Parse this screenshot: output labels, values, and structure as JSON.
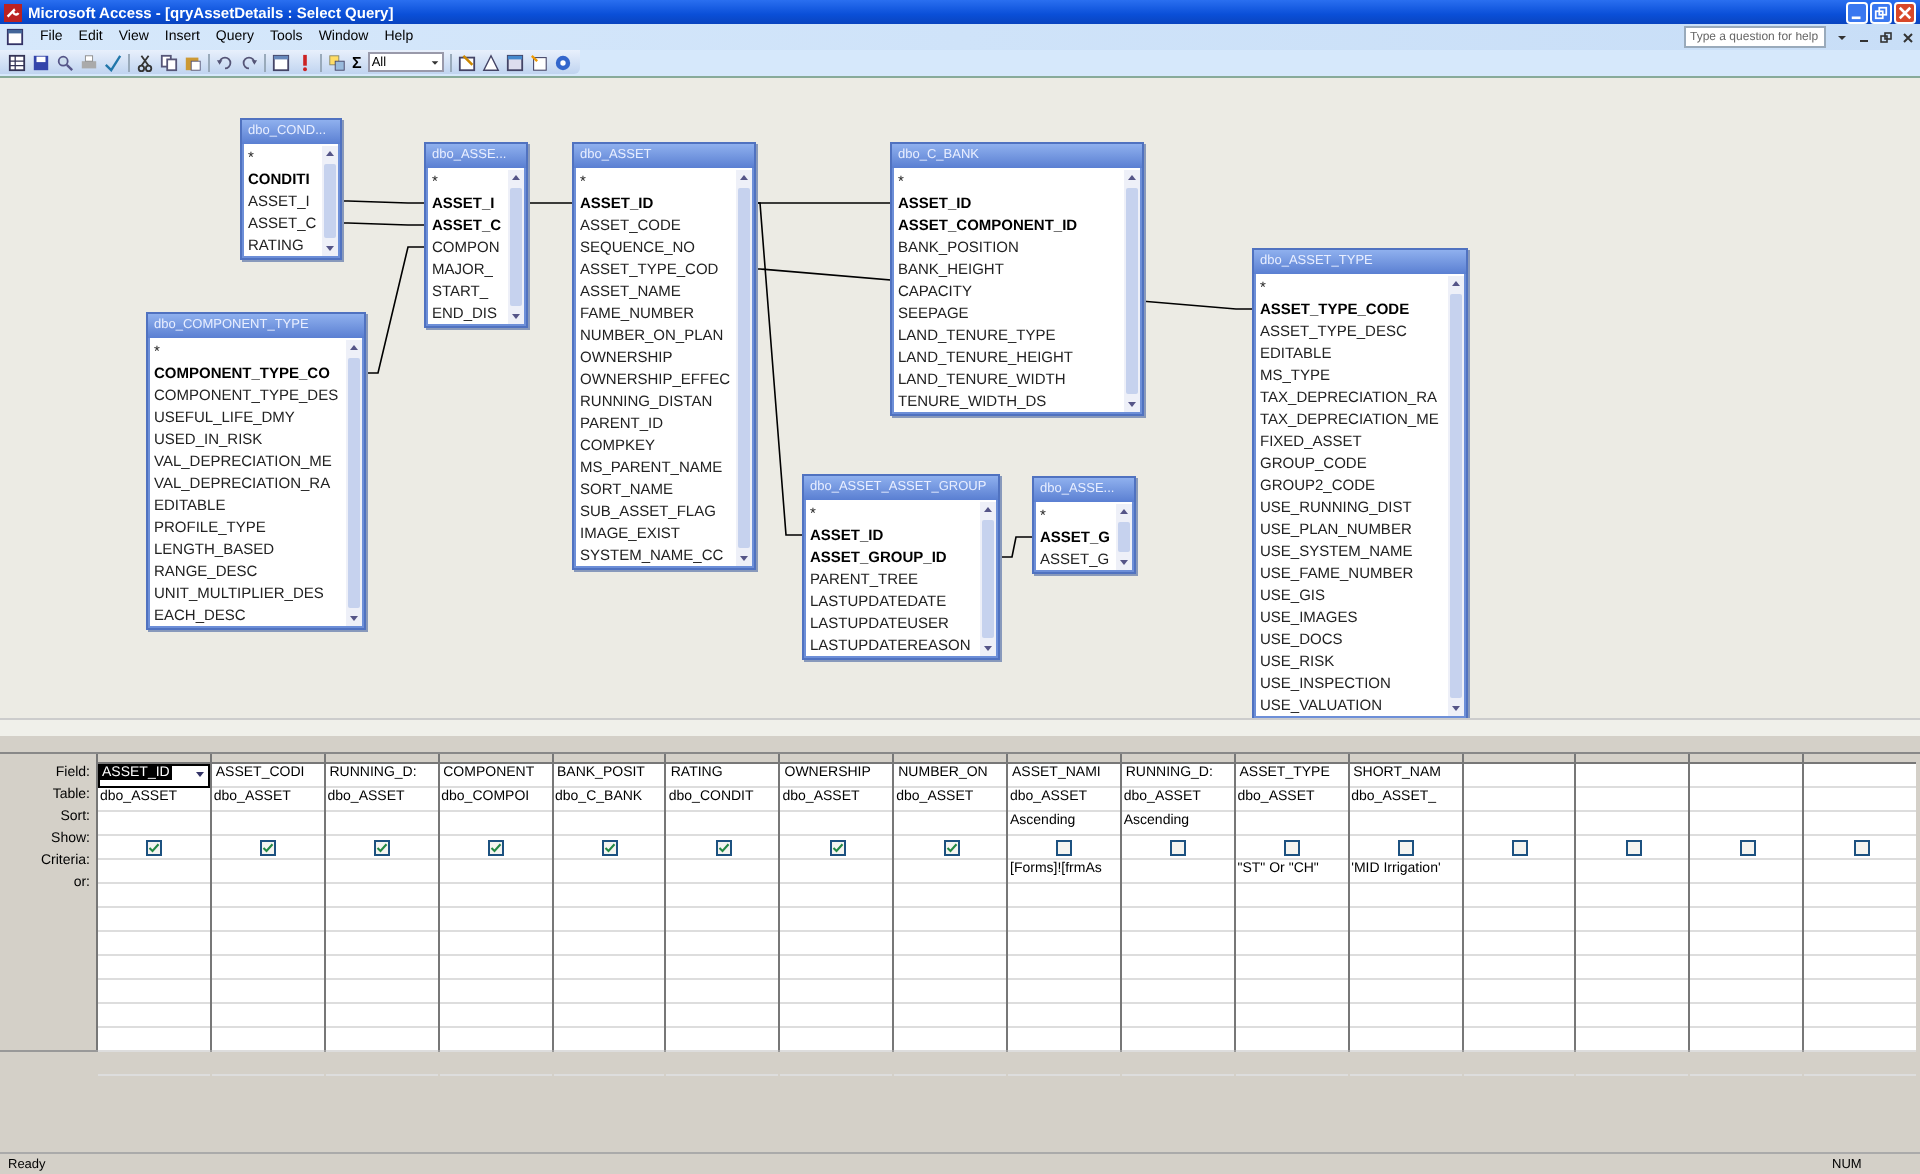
{
  "window": {
    "title": "Microsoft Access - [qryAssetDetails : Select Query]"
  },
  "menu": [
    "File",
    "Edit",
    "View",
    "Insert",
    "Query",
    "Tools",
    "Window",
    "Help"
  ],
  "help_box": {
    "placeholder": "Type a question for help"
  },
  "toolbar": {
    "totals_symbol": "Σ",
    "top_values": "All"
  },
  "tables": [
    {
      "title": "dbo_COND...",
      "fields": [
        {
          "name": "*",
          "key": false
        },
        {
          "name": "CONDITI",
          "key": true
        },
        {
          "name": "ASSET_I",
          "key": false
        },
        {
          "name": "ASSET_C",
          "key": false
        },
        {
          "name": "RATING",
          "key": false
        }
      ]
    },
    {
      "title": "dbo_ASSE...",
      "fields": [
        {
          "name": "*",
          "key": false
        },
        {
          "name": "ASSET_I",
          "key": true
        },
        {
          "name": "ASSET_C",
          "key": true
        },
        {
          "name": "COMPON",
          "key": false
        },
        {
          "name": "MAJOR_",
          "key": false
        },
        {
          "name": "START_",
          "key": false
        },
        {
          "name": "END_DIS",
          "key": false
        }
      ]
    },
    {
      "title": "dbo_ASSET",
      "fields": [
        {
          "name": "*",
          "key": false
        },
        {
          "name": "ASSET_ID",
          "key": true
        },
        {
          "name": "ASSET_CODE",
          "key": false
        },
        {
          "name": "SEQUENCE_NO",
          "key": false
        },
        {
          "name": "ASSET_TYPE_COD",
          "key": false
        },
        {
          "name": "ASSET_NAME",
          "key": false
        },
        {
          "name": "FAME_NUMBER",
          "key": false
        },
        {
          "name": "NUMBER_ON_PLAN",
          "key": false
        },
        {
          "name": "OWNERSHIP",
          "key": false
        },
        {
          "name": "OWNERSHIP_EFFEC",
          "key": false
        },
        {
          "name": "RUNNING_DISTAN",
          "key": false
        },
        {
          "name": "PARENT_ID",
          "key": false
        },
        {
          "name": "COMPKEY",
          "key": false
        },
        {
          "name": "MS_PARENT_NAME",
          "key": false
        },
        {
          "name": "SORT_NAME",
          "key": false
        },
        {
          "name": "SUB_ASSET_FLAG",
          "key": false
        },
        {
          "name": "IMAGE_EXIST",
          "key": false
        },
        {
          "name": "SYSTEM_NAME_CC",
          "key": false
        }
      ]
    },
    {
      "title": "dbo_COMPONENT_TYPE",
      "fields": [
        {
          "name": "*",
          "key": false
        },
        {
          "name": "COMPONENT_TYPE_CO",
          "key": true
        },
        {
          "name": "COMPONENT_TYPE_DES",
          "key": false
        },
        {
          "name": "USEFUL_LIFE_DMY",
          "key": false
        },
        {
          "name": "USED_IN_RISK",
          "key": false
        },
        {
          "name": "VAL_DEPRECIATION_ME",
          "key": false
        },
        {
          "name": "VAL_DEPRECIATION_RA",
          "key": false
        },
        {
          "name": "EDITABLE",
          "key": false
        },
        {
          "name": "PROFILE_TYPE",
          "key": false
        },
        {
          "name": "LENGTH_BASED",
          "key": false
        },
        {
          "name": "RANGE_DESC",
          "key": false
        },
        {
          "name": "UNIT_MULTIPLIER_DES",
          "key": false
        },
        {
          "name": "EACH_DESC",
          "key": false
        }
      ]
    },
    {
      "title": "dbo_C_BANK",
      "fields": [
        {
          "name": "*",
          "key": false
        },
        {
          "name": "ASSET_ID",
          "key": true
        },
        {
          "name": "ASSET_COMPONENT_ID",
          "key": true
        },
        {
          "name": "BANK_POSITION",
          "key": false
        },
        {
          "name": "BANK_HEIGHT",
          "key": false
        },
        {
          "name": "CAPACITY",
          "key": false
        },
        {
          "name": "SEEPAGE",
          "key": false
        },
        {
          "name": "LAND_TENURE_TYPE",
          "key": false
        },
        {
          "name": "LAND_TENURE_HEIGHT",
          "key": false
        },
        {
          "name": "LAND_TENURE_WIDTH",
          "key": false
        },
        {
          "name": "TENURE_WIDTH_DS",
          "key": false
        }
      ]
    },
    {
      "title": "dbo_ASSET_ASSET_GROUP",
      "fields": [
        {
          "name": "*",
          "key": false
        },
        {
          "name": "ASSET_ID",
          "key": true
        },
        {
          "name": "ASSET_GROUP_ID",
          "key": true
        },
        {
          "name": "PARENT_TREE",
          "key": false
        },
        {
          "name": "LASTUPDATEDATE",
          "key": false
        },
        {
          "name": "LASTUPDATEUSER",
          "key": false
        },
        {
          "name": "LASTUPDATEREASON",
          "key": false
        }
      ]
    },
    {
      "title": "dbo_ASSE...",
      "fields": [
        {
          "name": "*",
          "key": false
        },
        {
          "name": "ASSET_G",
          "key": true
        },
        {
          "name": "ASSET_G",
          "key": false
        }
      ]
    },
    {
      "title": "dbo_ASSET_TYPE",
      "fields": [
        {
          "name": "*",
          "key": false
        },
        {
          "name": "ASSET_TYPE_CODE",
          "key": true
        },
        {
          "name": "ASSET_TYPE_DESC",
          "key": false
        },
        {
          "name": "EDITABLE",
          "key": false
        },
        {
          "name": "MS_TYPE",
          "key": false
        },
        {
          "name": "TAX_DEPRECIATION_RA",
          "key": false
        },
        {
          "name": "TAX_DEPRECIATION_ME",
          "key": false
        },
        {
          "name": "FIXED_ASSET",
          "key": false
        },
        {
          "name": "GROUP_CODE",
          "key": false
        },
        {
          "name": "GROUP2_CODE",
          "key": false
        },
        {
          "name": "USE_RUNNING_DIST",
          "key": false
        },
        {
          "name": "USE_PLAN_NUMBER",
          "key": false
        },
        {
          "name": "USE_SYSTEM_NAME",
          "key": false
        },
        {
          "name": "USE_FAME_NUMBER",
          "key": false
        },
        {
          "name": "USE_GIS",
          "key": false
        },
        {
          "name": "USE_IMAGES",
          "key": false
        },
        {
          "name": "USE_DOCS",
          "key": false
        },
        {
          "name": "USE_RISK",
          "key": false
        },
        {
          "name": "USE_INSPECTION",
          "key": false
        },
        {
          "name": "USE_VALUATION",
          "key": false
        }
      ]
    }
  ],
  "grid": {
    "row_labels": [
      "Field:",
      "Table:",
      "Sort:",
      "Show:",
      "Criteria:",
      "or:"
    ],
    "columns": [
      {
        "field": "ASSET_ID",
        "table": "dbo_ASSET",
        "show": true,
        "selected": true
      },
      {
        "field": "ASSET_CODI",
        "table": "dbo_ASSET",
        "show": true,
        "selected": false
      },
      {
        "field": "RUNNING_D:",
        "table": "dbo_ASSET",
        "show": true,
        "selected": false
      },
      {
        "field": "COMPONENT",
        "table": "dbo_COMPOI",
        "show": true,
        "selected": false
      },
      {
        "field": "BANK_POSIT",
        "table": "dbo_C_BANK",
        "show": true,
        "selected": false
      },
      {
        "field": "RATING",
        "table": "dbo_CONDIT",
        "show": true,
        "selected": false
      },
      {
        "field": "OWNERSHIP",
        "table": "dbo_ASSET",
        "show": true,
        "selected": false
      },
      {
        "field": "NUMBER_ON",
        "table": "dbo_ASSET",
        "show": true,
        "selected": false
      },
      {
        "field": "ASSET_NAMI",
        "table": "dbo_ASSET",
        "sort": "Ascending",
        "show": false,
        "criteria": "[Forms]![frmAs",
        "selected": false
      },
      {
        "field": "RUNNING_D:",
        "table": "dbo_ASSET",
        "sort": "Ascending",
        "show": false,
        "selected": false
      },
      {
        "field": "ASSET_TYPE",
        "table": "dbo_ASSET",
        "show": false,
        "criteria": "\"ST\" Or \"CH\"",
        "selected": false
      },
      {
        "field": "SHORT_NAM",
        "table": "dbo_ASSET_",
        "show": false,
        "criteria": "'MID Irrigation'",
        "selected": false
      },
      {
        "show": false,
        "selected": false
      },
      {
        "show": false,
        "selected": false
      },
      {
        "show": false,
        "selected": false
      },
      {
        "show": false,
        "selected": false
      }
    ]
  },
  "status_bar": {
    "left": "Ready",
    "right": "NUM"
  }
}
